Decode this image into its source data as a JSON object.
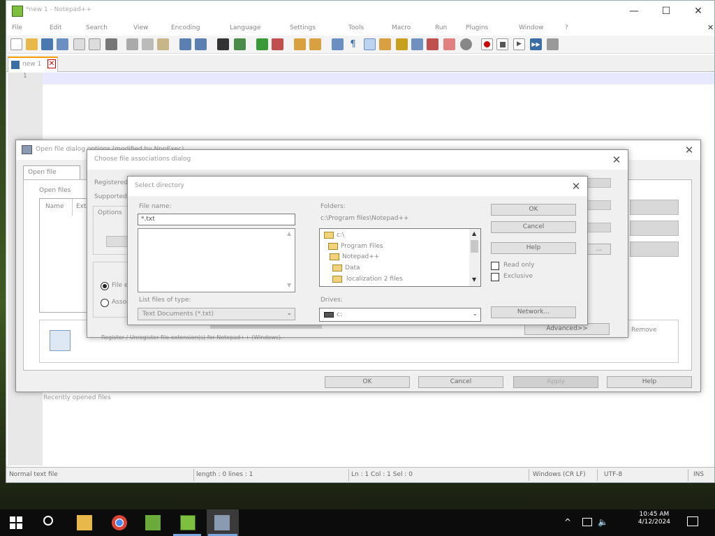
{
  "window": {
    "title": "*new 1 - Notepad++",
    "min": "—",
    "max": "☐",
    "close": "✕"
  },
  "menu": [
    "File",
    "Edit",
    "Search",
    "View",
    "Encoding",
    "Language",
    "Settings",
    "Tools",
    "Macro",
    "Run",
    "Plugins",
    "Window",
    "?"
  ],
  "tab": {
    "label": "new 1",
    "close": "✕"
  },
  "gutter": {
    "line": "1"
  },
  "status": {
    "type": "Normal text file",
    "length": "length : 0 lines : 1",
    "pos": "Ln : 1 Col : 1 Sel : 0",
    "eol": "Windows (CR LF)",
    "enc": "UTF-8",
    "ins": "INS"
  },
  "bg_dialog": {
    "title": "Open file dialog options (modified by NppExec)",
    "tab": "Open file",
    "label": "Open files",
    "col1": "Name",
    "col2": "Ext",
    "ok": "OK",
    "cancel": "Cancel",
    "apply": "Apply",
    "help": "Help",
    "status_under": "Recently opened files"
  },
  "mid_dialog": {
    "title": "Choose file associations dialog",
    "r1": "File ext",
    "r2": "Associate",
    "lbl_a": "Registered:",
    "lbl_b": "Supported:",
    "lbl_c": "Options",
    "btn_more": "Advanced>>",
    "dots": "...",
    "desc": "Register / Unregister file extension(s) for Notepad++ (Windows).",
    "side": "Remove"
  },
  "fg_dialog": {
    "title": "Select directory",
    "filename_label": "File name:",
    "filename_value": "*.txt",
    "folders_label": "Folders:",
    "folders_path": "c:\\Program files\\Notepad++",
    "folders": [
      "c:\\",
      "Program Files",
      "Notepad++",
      "Data",
      "localization 2 files"
    ],
    "ok": "OK",
    "cancel": "Cancel",
    "help": "Help",
    "network": "Network...",
    "readonly": "Read only",
    "exclusive": "Exclusive",
    "filetype_label": "List files of type:",
    "filetype_value": "Text Documents (*.txt)",
    "drives_label": "Drives:",
    "drives_value": "c:"
  },
  "taskbar": {
    "time": "10:45 AM",
    "date": "4/12/2024",
    "tray_up": "^",
    "speaker": "🔈"
  }
}
